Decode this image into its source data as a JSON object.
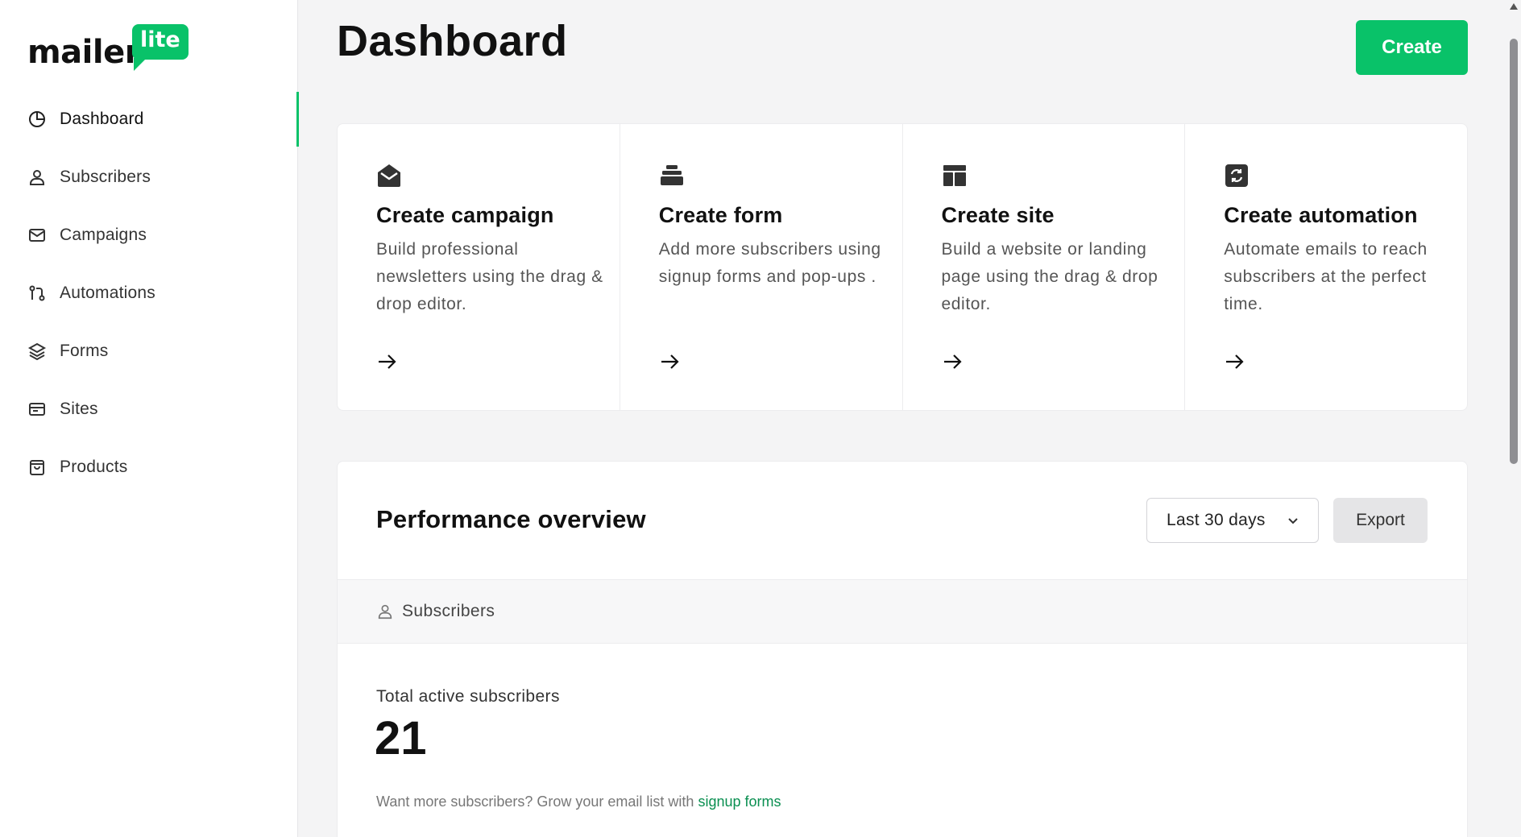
{
  "brand": {
    "word": "mailer",
    "badge": "lite",
    "accent": "#09c269"
  },
  "sidebar": {
    "items": [
      {
        "label": "Dashboard",
        "icon": "clock-pie-icon",
        "active": true
      },
      {
        "label": "Subscribers",
        "icon": "user-icon"
      },
      {
        "label": "Campaigns",
        "icon": "envelope-icon"
      },
      {
        "label": "Automations",
        "icon": "workflow-icon"
      },
      {
        "label": "Forms",
        "icon": "layers-icon"
      },
      {
        "label": "Sites",
        "icon": "browser-window-icon"
      },
      {
        "label": "Products",
        "icon": "shopping-bag-icon"
      }
    ]
  },
  "header": {
    "title": "Dashboard",
    "create_label": "Create"
  },
  "cards": [
    {
      "title": "Create campaign",
      "desc": "Build professional newsletters using the drag & drop editor.",
      "icon": "open-envelope-icon"
    },
    {
      "title": "Create form",
      "desc": "Add more subscribers using signup forms and pop-ups .",
      "icon": "form-stack-icon"
    },
    {
      "title": "Create site",
      "desc": "Build a website or landing page using the drag & drop editor.",
      "icon": "layout-icon"
    },
    {
      "title": "Create automation",
      "desc": "Automate emails to reach subscribers at the perfect time.",
      "icon": "sync-icon"
    }
  ],
  "performance": {
    "title": "Performance overview",
    "range": "Last 30 days",
    "export_label": "Export",
    "tab_label": "Subscribers",
    "metric_label": "Total active subscribers",
    "metric_value": "21",
    "hint_text": "Want more subscribers? Grow your email list with",
    "hint_link": "signup forms"
  }
}
